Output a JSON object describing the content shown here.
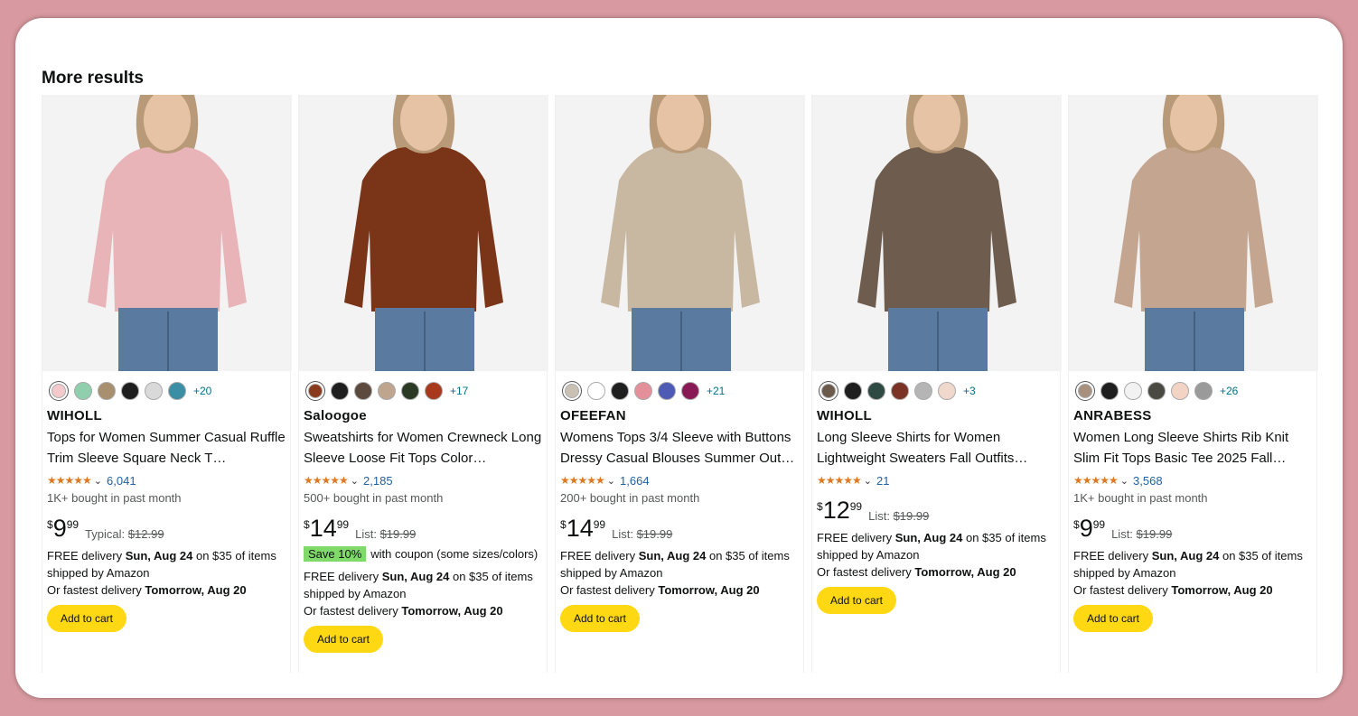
{
  "section": {
    "title": "More results"
  },
  "products": [
    {
      "brand": "WIHOLL",
      "title": "Tops for Women Summer Casual Ruffle Trim Sleeve Square Neck T…",
      "swatches": [
        "#f4c9cc",
        "#8fcfae",
        "#a88f70",
        "#1f1f1f",
        "#d9d9d9",
        "#3a8fa4"
      ],
      "more_colors": "+20",
      "rating": "4.4",
      "review_count": "6,041",
      "bought": "1K+ bought in past month",
      "price_currency": "$",
      "price_whole": "9",
      "price_fraction": "99",
      "list_label": "Typical:",
      "list_price": "$12.99",
      "coupon": null,
      "delivery_prefix": "FREE delivery",
      "delivery_date": "Sun, Aug 24",
      "delivery_suffix": "on $35 of items shipped by Amazon",
      "fastest_prefix": "Or fastest delivery",
      "fastest_date": "Tomorrow, Aug 20",
      "cart_label": "Add to cart",
      "garment_color": "#e8b4b8"
    },
    {
      "brand": "Saloogoe",
      "title": "Sweatshirts for Women Crewneck Long Sleeve Loose Fit Tops Color…",
      "swatches": [
        "#8a3a1c",
        "#1f1f1f",
        "#5d4a3e",
        "#bfa58e",
        "#2a3a25",
        "#a8391d"
      ],
      "more_colors": "+17",
      "rating": "4.3",
      "review_count": "2,185",
      "bought": "500+ bought in past month",
      "price_currency": "$",
      "price_whole": "14",
      "price_fraction": "99",
      "list_label": "List:",
      "list_price": "$19.99",
      "coupon": {
        "badge": "Save 10%",
        "text": "with coupon (some sizes/colors)"
      },
      "delivery_prefix": "FREE delivery",
      "delivery_date": "Sun, Aug 24",
      "delivery_suffix": "on $35 of items shipped by Amazon",
      "fastest_prefix": "Or fastest delivery",
      "fastest_date": "Tomorrow, Aug 20",
      "cart_label": "Add to cart",
      "garment_color": "#7a3418"
    },
    {
      "brand": "OFEEFAN",
      "title": "Womens Tops 3/4 Sleeve with Buttons Dressy Casual Blouses Summer Out…",
      "swatches": [
        "#c9c2b4",
        "#ffffff",
        "#1f1f1f",
        "#e3909a",
        "#4e5bb5",
        "#8a1a55"
      ],
      "more_colors": "+21",
      "rating": "4.3",
      "review_count": "1,664",
      "bought": "200+ bought in past month",
      "price_currency": "$",
      "price_whole": "14",
      "price_fraction": "99",
      "list_label": "List:",
      "list_price": "$19.99",
      "coupon": null,
      "delivery_prefix": "FREE delivery",
      "delivery_date": "Sun, Aug 24",
      "delivery_suffix": "on $35 of items shipped by Amazon",
      "fastest_prefix": "Or fastest delivery",
      "fastest_date": "Tomorrow, Aug 20",
      "cart_label": "Add to cart",
      "garment_color": "#c8b8a2"
    },
    {
      "brand": "WIHOLL",
      "title": "Long Sleeve Shirts for Women Lightweight Sweaters Fall Outfits…",
      "swatches": [
        "#6b5a4b",
        "#1f1f1f",
        "#2f4a42",
        "#7a3324",
        "#b5b5b5",
        "#f1d8cc"
      ],
      "more_colors": "+3",
      "rating": "4.2",
      "review_count": "21",
      "bought": "",
      "price_currency": "$",
      "price_whole": "12",
      "price_fraction": "99",
      "list_label": "List:",
      "list_price": "$19.99",
      "coupon": null,
      "delivery_prefix": "FREE delivery",
      "delivery_date": "Sun, Aug 24",
      "delivery_suffix": "on $35 of items shipped by Amazon",
      "fastest_prefix": "Or fastest delivery",
      "fastest_date": "Tomorrow, Aug 20",
      "cart_label": "Add to cart",
      "garment_color": "#6e5d4e"
    },
    {
      "brand": "ANRABESS",
      "title": "Women Long Sleeve Shirts Rib Knit Slim Fit Tops Basic Tee 2025 Fall…",
      "swatches": [
        "#a8907e",
        "#1f1f1f",
        "#f2f2f2",
        "#4a4a42",
        "#f3d4c4",
        "#9a9a9a"
      ],
      "more_colors": "+26",
      "rating": "4.3",
      "review_count": "3,568",
      "bought": "1K+ bought in past month",
      "price_currency": "$",
      "price_whole": "9",
      "price_fraction": "99",
      "list_label": "List:",
      "list_price": "$19.99",
      "coupon": null,
      "delivery_prefix": "FREE delivery",
      "delivery_date": "Sun, Aug 24",
      "delivery_suffix": "on $35 of items shipped by Amazon",
      "fastest_prefix": "Or fastest delivery",
      "fastest_date": "Tomorrow, Aug 20",
      "cart_label": "Add to cart",
      "garment_color": "#c4a590"
    }
  ],
  "icons": {
    "stars": "star-rating-icon",
    "chevron": "chevron-down-icon"
  },
  "colors": {
    "accent_button": "#ffd814",
    "link": "#2162a1",
    "star": "#de7921",
    "coupon_badge": "#7fda69"
  }
}
